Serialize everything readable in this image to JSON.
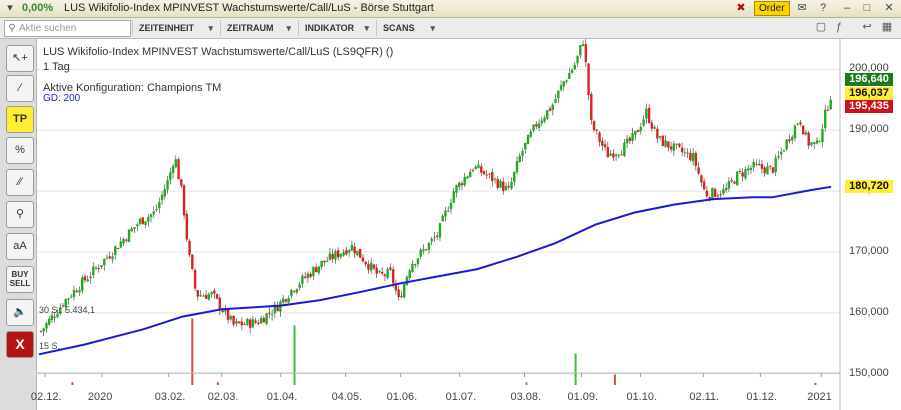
{
  "window": {
    "change_pct": "0,00%",
    "title": "LUS Wikifolio-Index MPINVEST Wachstumswerte/Call/LuS - Börse Stuttgart",
    "order_label": "Order"
  },
  "toolbar": {
    "search_placeholder": "Aktie suchen",
    "menus": [
      "ZEITEINHEIT",
      "ZEITRAUM",
      "INDIKATOR",
      "SCANS"
    ]
  },
  "tools": {
    "tp": "TP",
    "percent": "%",
    "aa": "aA",
    "buy": "BUY",
    "sell": "SELL",
    "close": "X"
  },
  "chart_info": {
    "line1": "LUS Wikifolio-Index MPINVEST Wachstumswerte/Call/LuS (LS9QFR) ()",
    "line2": "1 Tag",
    "line3": "Aktive Konfiguration: Champions TM",
    "line4": "GD: 200",
    "vol_label1": "30 S.: 5.434,1",
    "vol_label2": "15 S."
  },
  "price_tags": {
    "high": "196,640",
    "last": "196,037",
    "low": "195,435",
    "ma": "180,720"
  },
  "colors": {
    "up": "#22aa22",
    "down": "#dd2222",
    "ma": "#1a1ad0",
    "tag_high": "#1c7a1c",
    "tag_last": "#ffee33",
    "tag_low": "#cc1122",
    "tag_ma": "#ffee33"
  },
  "chart_data": {
    "type": "candlestick",
    "y_ticks": [
      "150,000",
      "160,000",
      "170,000",
      "180,000",
      "190,000",
      "200,000"
    ],
    "y_tick_values": [
      150000,
      160000,
      170000,
      180000,
      190000,
      200000
    ],
    "ylim": [
      147500,
      205000
    ],
    "x_ticks": [
      "02.12.",
      "2020",
      "03.02.",
      "02.03.",
      "01.04.",
      "04.05.",
      "01.06.",
      "01.07.",
      "03.08.",
      "01.09.",
      "01.10.",
      "02.11.",
      "01.12.",
      "2021"
    ],
    "x_tick_days": [
      0,
      29,
      63,
      90,
      120,
      153,
      181,
      211,
      244,
      273,
      303,
      335,
      364,
      395
    ],
    "x_range_days": [
      -3,
      403
    ],
    "close_path": [
      [
        -2,
        157000
      ],
      [
        10,
        162000
      ],
      [
        22,
        166000
      ],
      [
        34,
        170000
      ],
      [
        48,
        175000
      ],
      [
        56,
        176500
      ],
      [
        63,
        182000
      ],
      [
        66,
        186000
      ],
      [
        70,
        179000
      ],
      [
        73,
        170000
      ],
      [
        77,
        163000
      ],
      [
        85,
        163000
      ],
      [
        96,
        158000
      ],
      [
        108,
        158500
      ],
      [
        118,
        161000
      ],
      [
        126,
        164000
      ],
      [
        140,
        168000
      ],
      [
        156,
        171000
      ],
      [
        163,
        168500
      ],
      [
        170,
        166000
      ],
      [
        176,
        166500
      ],
      [
        180,
        162000
      ],
      [
        186,
        168000
      ],
      [
        192,
        170000
      ],
      [
        200,
        173000
      ],
      [
        208,
        180000
      ],
      [
        218,
        184000
      ],
      [
        228,
        182000
      ],
      [
        236,
        180000
      ],
      [
        242,
        186000
      ],
      [
        250,
        191000
      ],
      [
        258,
        194000
      ],
      [
        264,
        198000
      ],
      [
        270,
        201000
      ],
      [
        274,
        205000
      ],
      [
        278,
        191000
      ],
      [
        286,
        186000
      ],
      [
        294,
        187000
      ],
      [
        300,
        189000
      ],
      [
        306,
        193000
      ],
      [
        312,
        188500
      ],
      [
        320,
        187000
      ],
      [
        330,
        185500
      ],
      [
        336,
        179500
      ],
      [
        346,
        180000
      ],
      [
        352,
        182500
      ],
      [
        360,
        184000
      ],
      [
        370,
        183500
      ],
      [
        378,
        188500
      ],
      [
        384,
        192000
      ],
      [
        388,
        188000
      ],
      [
        393,
        187500
      ],
      [
        397,
        192500
      ],
      [
        400,
        196037
      ]
    ],
    "ma_path": [
      [
        -3,
        153200
      ],
      [
        20,
        154800
      ],
      [
        50,
        157300
      ],
      [
        70,
        159400
      ],
      [
        90,
        160600
      ],
      [
        120,
        161200
      ],
      [
        140,
        162100
      ],
      [
        160,
        163400
      ],
      [
        180,
        164800
      ],
      [
        200,
        166000
      ],
      [
        220,
        167200
      ],
      [
        240,
        169200
      ],
      [
        260,
        171500
      ],
      [
        280,
        174500
      ],
      [
        300,
        176500
      ],
      [
        320,
        177800
      ],
      [
        340,
        178700
      ],
      [
        360,
        179000
      ],
      [
        370,
        179000
      ],
      [
        390,
        180200
      ],
      [
        400,
        180720
      ]
    ],
    "volume_spikes": [
      {
        "day": 75,
        "height": 0.95,
        "color": "#dd2222"
      },
      {
        "day": 88,
        "height": 0.04,
        "color": "#dd2222"
      },
      {
        "day": 127,
        "height": 0.85,
        "color": "#22aa22"
      },
      {
        "day": 270,
        "height": 0.45,
        "color": "#22aa22"
      },
      {
        "day": 290,
        "height": 0.15,
        "color": "#dd2222"
      },
      {
        "day": 14,
        "height": 0.04,
        "color": "#dd2222"
      },
      {
        "day": 245,
        "height": 0.04,
        "color": "#22aa22"
      },
      {
        "day": 392,
        "height": 0.03,
        "color": "#dd2222"
      }
    ]
  }
}
